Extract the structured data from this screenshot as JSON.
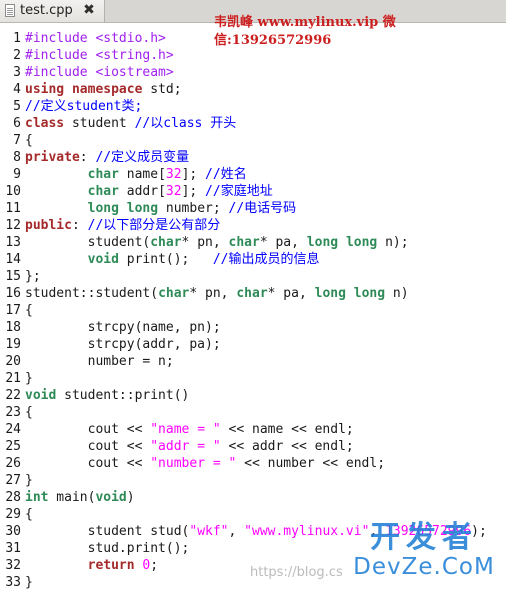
{
  "tab": {
    "label": "test.cpp",
    "close_symbol": "✖",
    "icon": "file-icon"
  },
  "watermarks": {
    "top": "韦凯峰 www.mylinux.vip 微信:13926572996",
    "bottom_chinese": "开发者",
    "bottom_latin": "DevZe.CoM",
    "blog": "https://blog.cs"
  },
  "colors": {
    "preprocessor": "#a020f0",
    "keyword": "#a52a2a",
    "type": "#2e8b57",
    "string": "#ff00ff",
    "comment": "#0000ff",
    "watermark_red": "#cc2020",
    "watermark_blue": "#1f7fd6"
  },
  "code_lines": [
    {
      "n": "1",
      "tokens": [
        [
          "pp",
          "#include <stdio.h>"
        ]
      ]
    },
    {
      "n": "2",
      "tokens": [
        [
          "pp",
          "#include <string.h>"
        ]
      ]
    },
    {
      "n": "3",
      "tokens": [
        [
          "pp",
          "#include <iostream>"
        ]
      ]
    },
    {
      "n": "4",
      "tokens": [
        [
          "kw",
          "using"
        ],
        [
          "pl",
          " "
        ],
        [
          "kw",
          "namespace"
        ],
        [
          "pl",
          " std;"
        ]
      ]
    },
    {
      "n": "5",
      "tokens": [
        [
          "cm",
          "//定义student类;"
        ]
      ]
    },
    {
      "n": "6",
      "tokens": [
        [
          "kw",
          "class"
        ],
        [
          "pl",
          " student "
        ],
        [
          "cm",
          "//以class 开头"
        ]
      ]
    },
    {
      "n": "7",
      "tokens": [
        [
          "pl",
          "{"
        ]
      ]
    },
    {
      "n": "8",
      "tokens": [
        [
          "kw",
          "private"
        ],
        [
          "pl",
          ": "
        ],
        [
          "cm",
          "//定义成员变量"
        ]
      ]
    },
    {
      "n": "9",
      "tokens": [
        [
          "pl",
          "        "
        ],
        [
          "ty",
          "char"
        ],
        [
          "pl",
          " name["
        ],
        [
          "num",
          "32"
        ],
        [
          "pl",
          "]; "
        ],
        [
          "cm",
          "//姓名"
        ]
      ]
    },
    {
      "n": "10",
      "tokens": [
        [
          "pl",
          "        "
        ],
        [
          "ty",
          "char"
        ],
        [
          "pl",
          " addr["
        ],
        [
          "num",
          "32"
        ],
        [
          "pl",
          "]; "
        ],
        [
          "cm",
          "//家庭地址"
        ]
      ]
    },
    {
      "n": "11",
      "tokens": [
        [
          "pl",
          "        "
        ],
        [
          "ty",
          "long"
        ],
        [
          "pl",
          " "
        ],
        [
          "ty",
          "long"
        ],
        [
          "pl",
          " number; "
        ],
        [
          "cm",
          "//电话号码"
        ]
      ]
    },
    {
      "n": "12",
      "tokens": [
        [
          "kw",
          "public"
        ],
        [
          "pl",
          ": "
        ],
        [
          "cm",
          "//以下部分是公有部分"
        ]
      ]
    },
    {
      "n": "13",
      "tokens": [
        [
          "pl",
          "        student("
        ],
        [
          "ty",
          "char"
        ],
        [
          "pl",
          "* pn, "
        ],
        [
          "ty",
          "char"
        ],
        [
          "pl",
          "* pa, "
        ],
        [
          "ty",
          "long"
        ],
        [
          "pl",
          " "
        ],
        [
          "ty",
          "long"
        ],
        [
          "pl",
          " n);"
        ]
      ]
    },
    {
      "n": "14",
      "tokens": [
        [
          "pl",
          "        "
        ],
        [
          "ty",
          "void"
        ],
        [
          "pl",
          " print();   "
        ],
        [
          "cm",
          "//输出成员的信息"
        ]
      ]
    },
    {
      "n": "15",
      "tokens": [
        [
          "pl",
          "};"
        ]
      ]
    },
    {
      "n": "16",
      "tokens": [
        [
          "pl",
          "student::student("
        ],
        [
          "ty",
          "char"
        ],
        [
          "pl",
          "* pn, "
        ],
        [
          "ty",
          "char"
        ],
        [
          "pl",
          "* pa, "
        ],
        [
          "ty",
          "long"
        ],
        [
          "pl",
          " "
        ],
        [
          "ty",
          "long"
        ],
        [
          "pl",
          " n)"
        ]
      ]
    },
    {
      "n": "17",
      "tokens": [
        [
          "pl",
          "{"
        ]
      ]
    },
    {
      "n": "18",
      "tokens": [
        [
          "pl",
          "        strcpy(name, pn);"
        ]
      ]
    },
    {
      "n": "19",
      "tokens": [
        [
          "pl",
          "        strcpy(addr, pa);"
        ]
      ]
    },
    {
      "n": "20",
      "tokens": [
        [
          "pl",
          "        number = n;"
        ]
      ]
    },
    {
      "n": "21",
      "tokens": [
        [
          "pl",
          "}"
        ]
      ]
    },
    {
      "n": "22",
      "tokens": [
        [
          "ty",
          "void"
        ],
        [
          "pl",
          " student::print()"
        ]
      ]
    },
    {
      "n": "23",
      "tokens": [
        [
          "pl",
          "{"
        ]
      ]
    },
    {
      "n": "24",
      "tokens": [
        [
          "pl",
          "        cout << "
        ],
        [
          "str",
          "\"name = \""
        ],
        [
          "pl",
          " << name << endl;"
        ]
      ]
    },
    {
      "n": "25",
      "tokens": [
        [
          "pl",
          "        cout << "
        ],
        [
          "str",
          "\"addr = \""
        ],
        [
          "pl",
          " << addr << endl;"
        ]
      ]
    },
    {
      "n": "26",
      "tokens": [
        [
          "pl",
          "        cout << "
        ],
        [
          "str",
          "\"number = \""
        ],
        [
          "pl",
          " << number << endl;"
        ]
      ]
    },
    {
      "n": "27",
      "tokens": [
        [
          "pl",
          "}"
        ]
      ]
    },
    {
      "n": "28",
      "tokens": [
        [
          "ty",
          "int"
        ],
        [
          "pl",
          " main("
        ],
        [
          "ty",
          "void"
        ],
        [
          "pl",
          ")"
        ]
      ]
    },
    {
      "n": "29",
      "tokens": [
        [
          "pl",
          "{"
        ]
      ]
    },
    {
      "n": "30",
      "tokens": [
        [
          "pl",
          "        student stud("
        ],
        [
          "str",
          "\"wkf\""
        ],
        [
          "pl",
          ", "
        ],
        [
          "str",
          "\"www.mylinux.vi\""
        ],
        [
          "pl",
          ", "
        ],
        [
          "num",
          "13926572996"
        ],
        [
          "pl",
          ");"
        ]
      ]
    },
    {
      "n": "31",
      "tokens": [
        [
          "pl",
          "        stud.print();"
        ]
      ]
    },
    {
      "n": "32",
      "tokens": [
        [
          "pl",
          "        "
        ],
        [
          "kw",
          "return"
        ],
        [
          "pl",
          " "
        ],
        [
          "num",
          "0"
        ],
        [
          "pl",
          ";"
        ]
      ]
    },
    {
      "n": "33",
      "tokens": [
        [
          "pl",
          "}"
        ]
      ]
    }
  ]
}
